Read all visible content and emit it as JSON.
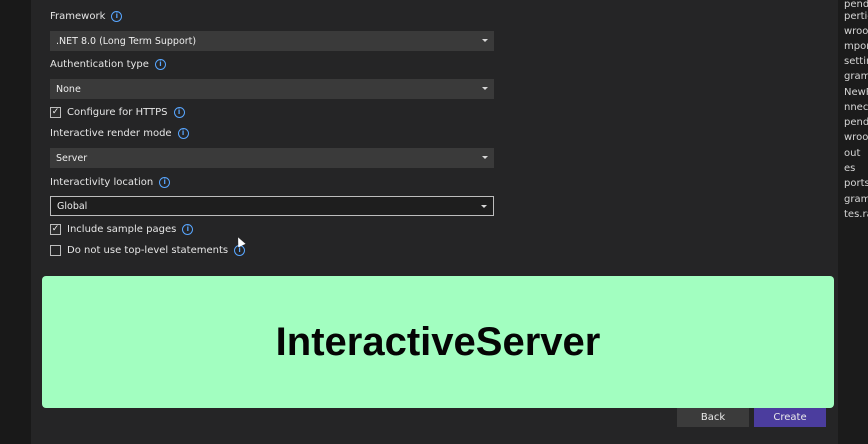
{
  "form": {
    "framework": {
      "label": "Framework",
      "value": ".NET 8.0 (Long Term Support)"
    },
    "auth": {
      "label": "Authentication type",
      "value": "None"
    },
    "https": {
      "label": "Configure for HTTPS",
      "checked": true
    },
    "render_mode": {
      "label": "Interactive render mode",
      "value": "Server"
    },
    "interactivity_location": {
      "label": "Interactivity location",
      "value": "Global"
    },
    "sample_pages": {
      "label": "Include sample pages",
      "checked": true
    },
    "top_level": {
      "label": "Do not use top-level statements",
      "checked": false
    }
  },
  "overlay": {
    "text": "InteractiveServer"
  },
  "buttons": {
    "back": "Back",
    "create": "Create"
  },
  "right_panel": {
    "lines": [
      "pende",
      "pertie",
      "wroot",
      "mpone",
      "settin",
      "gram.",
      "NewFe",
      "nnecte",
      "pende",
      "wroot",
      "out",
      "es",
      "ports.",
      "gram.",
      "tes.ra"
    ]
  },
  "colors": {
    "accent": "#4b3d9e",
    "overlay_bg": "#a2fec0",
    "info_icon": "#58a6ff"
  }
}
